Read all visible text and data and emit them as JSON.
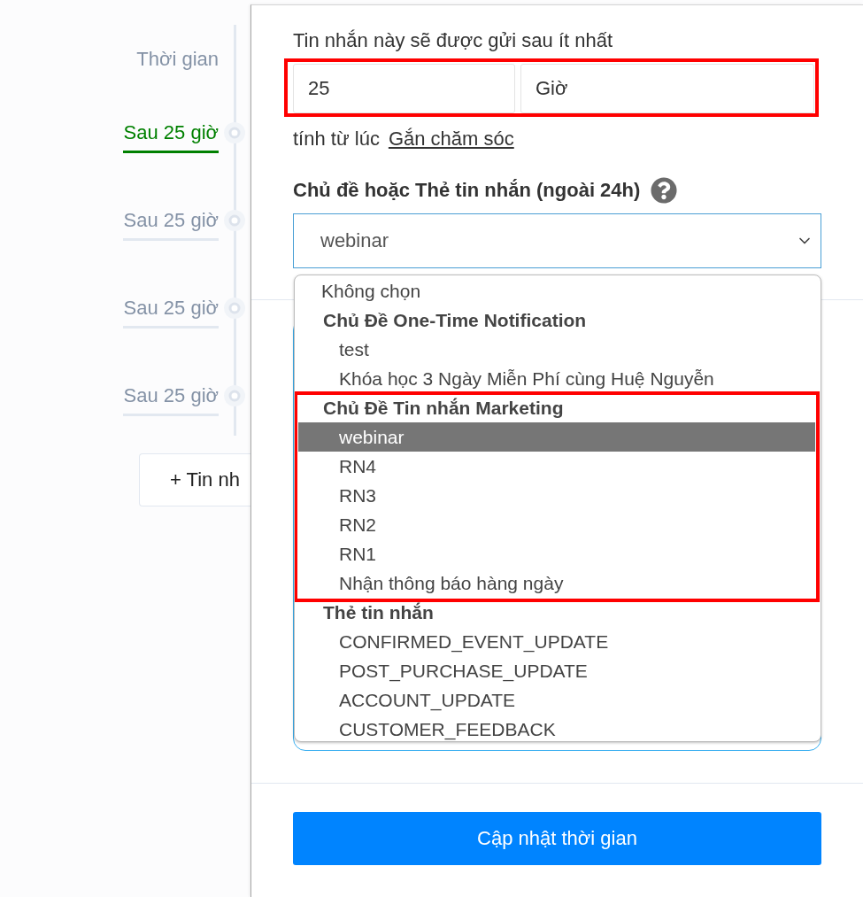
{
  "timeline": {
    "heading": "Thời gian",
    "steps": [
      {
        "label": "Sau 25 giờ",
        "selected": true
      },
      {
        "label": "Sau 25 giờ",
        "selected": false
      },
      {
        "label": "Sau 25 giờ",
        "selected": false
      },
      {
        "label": "Sau 25 giờ",
        "selected": false
      }
    ],
    "add_button": "+ Tin nh"
  },
  "panel": {
    "delay_label": "Tin nhắn này sẽ được gửi sau ít nhất",
    "delay": {
      "value": "25",
      "unit": "Giờ",
      "highlighted": true
    },
    "since_label": "tính từ lúc",
    "since_link": "Gắn chăm sóc",
    "topic_label": "Chủ đề hoặc Thẻ tin nhắn (ngoài 24h)",
    "topic_select": {
      "value": "webinar",
      "expanded": true
    },
    "topic_options": [
      {
        "kind": "option",
        "label": "Không chọn",
        "selected": false
      },
      {
        "kind": "group",
        "label": "Chủ Đề One-Time Notification",
        "highlighted": false,
        "children": [
          {
            "label": "test",
            "selected": false
          },
          {
            "label": "Khóa học 3 Ngày Miễn Phí cùng Huệ Nguyễn",
            "selected": false
          }
        ]
      },
      {
        "kind": "group",
        "label": "Chủ Đề Tin nhắn Marketing",
        "highlighted": true,
        "children": [
          {
            "label": "webinar",
            "selected": true
          },
          {
            "label": "RN4",
            "selected": false
          },
          {
            "label": "RN3",
            "selected": false
          },
          {
            "label": "RN2",
            "selected": false
          },
          {
            "label": "RN1",
            "selected": false
          },
          {
            "label": "Nhận thông báo hàng ngày",
            "selected": false
          }
        ]
      },
      {
        "kind": "group",
        "label": "Thẻ tin nhắn",
        "highlighted": false,
        "children": [
          {
            "label": "CONFIRMED_EVENT_UPDATE",
            "selected": false
          },
          {
            "label": "POST_PURCHASE_UPDATE",
            "selected": false
          },
          {
            "label": "ACCOUNT_UPDATE",
            "selected": false
          },
          {
            "label": "CUSTOMER_FEEDBACK",
            "selected": false
          }
        ]
      }
    ],
    "submit_button": "Cập nhật thời gian"
  }
}
